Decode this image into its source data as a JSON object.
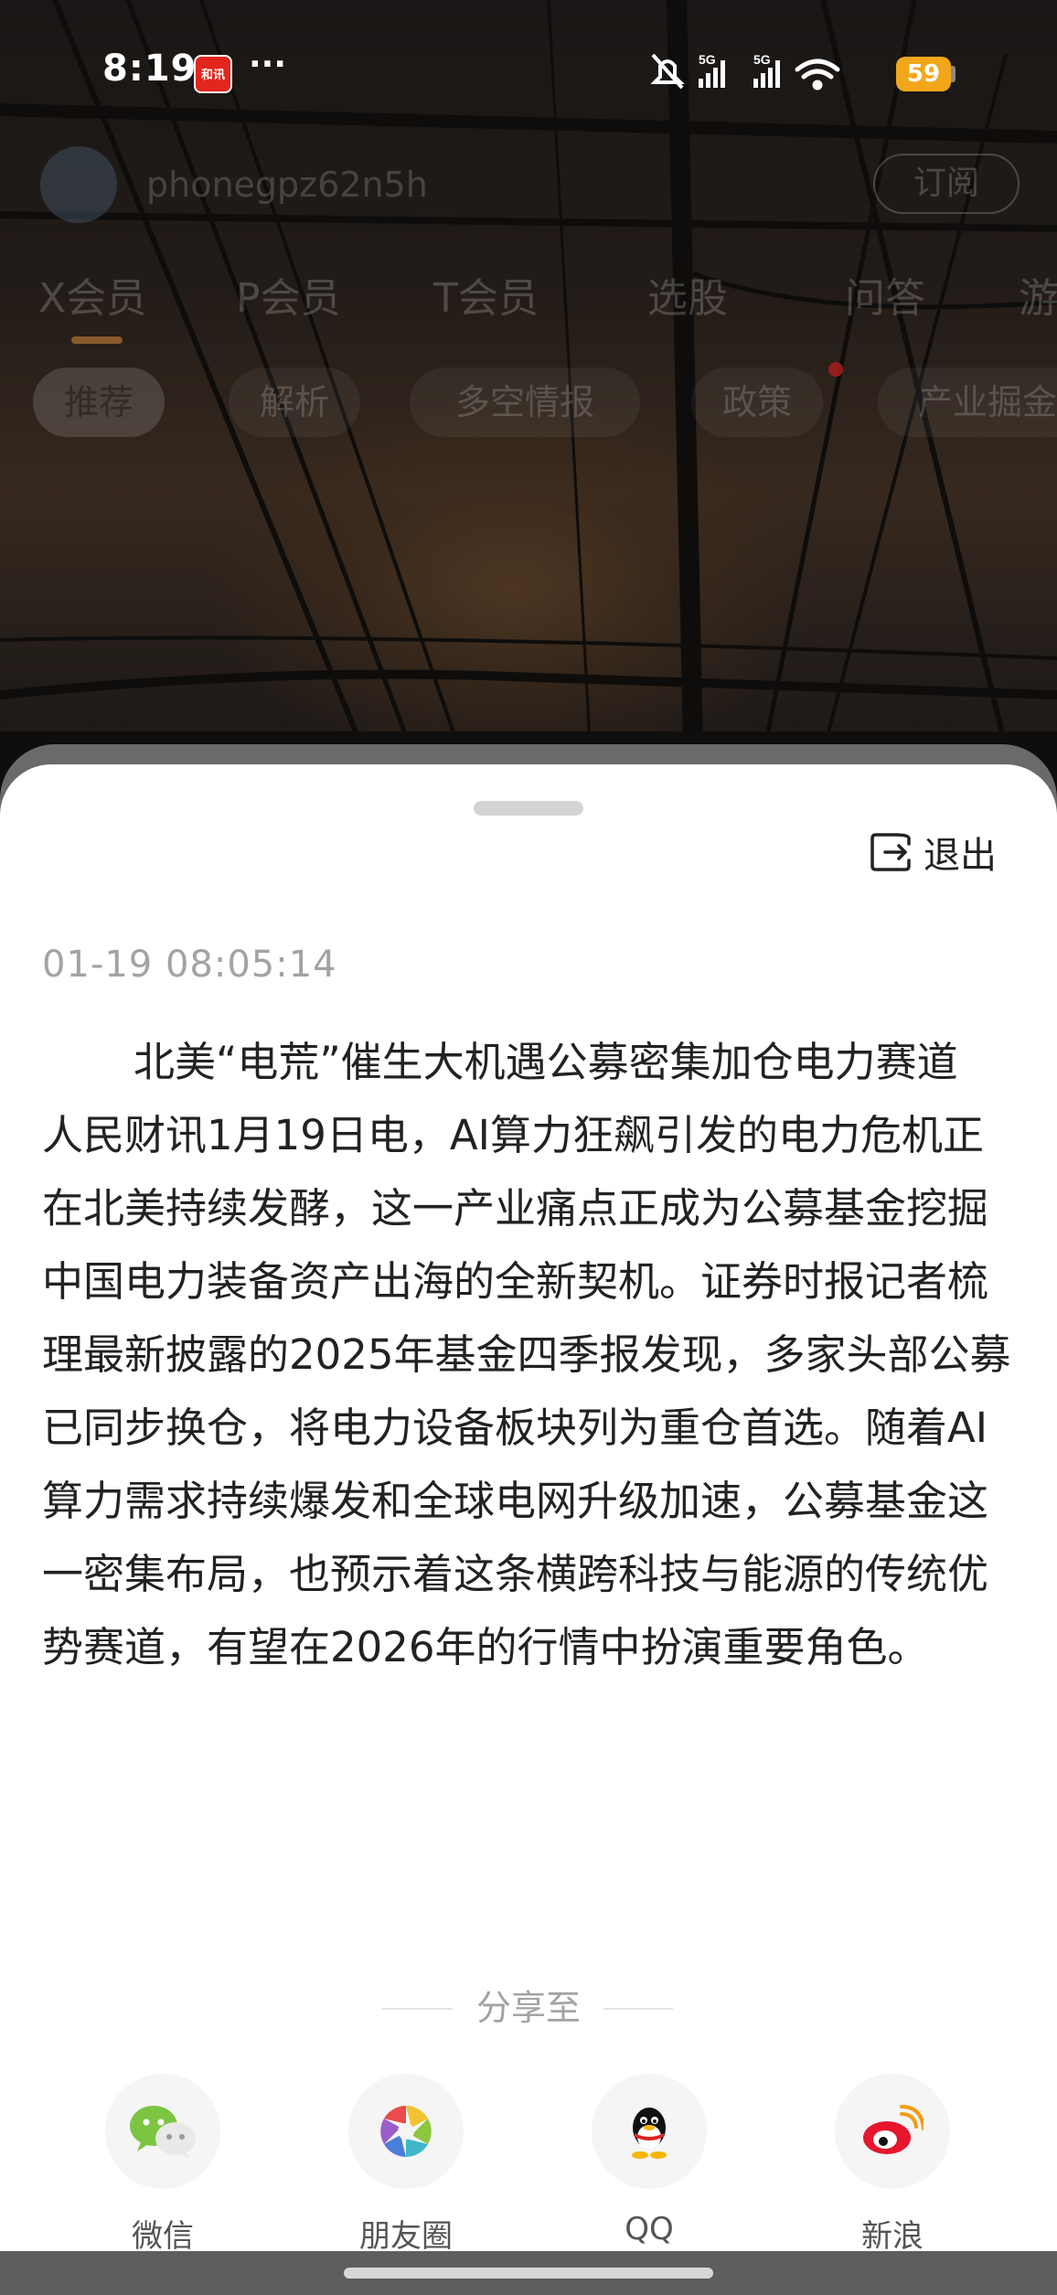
{
  "status_bar": {
    "time": "8:19",
    "app_badge": "和讯",
    "more": "···",
    "battery": "59",
    "network": [
      "5G",
      "5G"
    ]
  },
  "header": {
    "user_name": "phonegpz62n5h",
    "subscribe_label": "订阅",
    "member_tabs": [
      "X会员",
      "P会员",
      "T会员",
      "选股",
      "问答",
      "游"
    ],
    "filter_chips": [
      "推荐",
      "解析",
      "多空情报",
      "政策",
      "产业掘金"
    ]
  },
  "sheet": {
    "exit_label": "退出",
    "timestamp": "01-19 08:05:14",
    "title": "北美“电荒”催生大机遇公募密集加仓电力赛道",
    "body": "人民财讯1月19日电，AI算力狂飙引发的电力危机正在北美持续发酵，这一产业痛点正成为公募基金挖掘中国电力装备资产出海的全新契机。证券时报记者梳理最新披露的2025年基金四季报发现，多家头部公募已同步换仓，将电力设备板块列为重仓首选。随着AI算力需求持续爆发和全球电网升级加速，公募基金这一密集布局，也预示着这条横跨科技与能源的传统优势赛道，有望在2026年的行情中扮演重要角色。",
    "share_label": "分享至",
    "share_targets": [
      {
        "label": "微信",
        "icon": "wechat-icon"
      },
      {
        "label": "朋友圈",
        "icon": "moments-icon"
      },
      {
        "label": "QQ",
        "icon": "qq-icon"
      },
      {
        "label": "新浪",
        "icon": "weibo-icon"
      }
    ]
  },
  "colors": {
    "accent_battery": "#f2a71b",
    "text_primary": "#222222",
    "text_muted": "#a3a3a3",
    "app_badge_red": "#e2261d"
  }
}
